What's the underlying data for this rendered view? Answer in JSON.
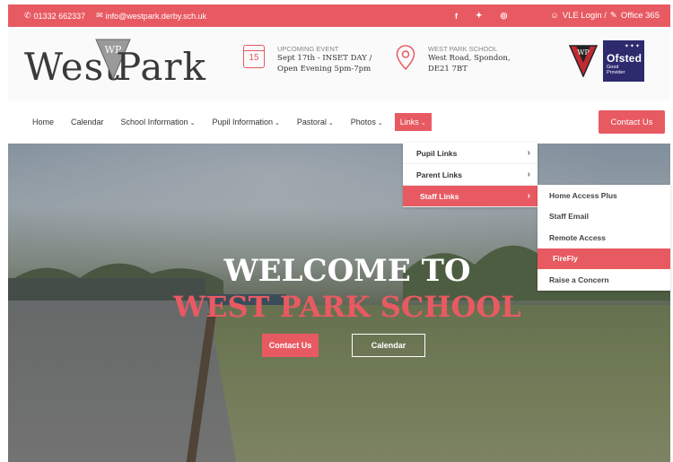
{
  "topbar": {
    "phone": "01332 662337",
    "email": "info@westpark.derby.sch.uk",
    "social_icons": [
      "facebook-icon",
      "twitter-icon",
      "instagram-icon"
    ],
    "vle_login": "VLE Login /",
    "office365": "Office 365"
  },
  "header": {
    "logo_left": "West",
    "logo_right": "Park",
    "logo_mark": "WP",
    "event": {
      "label": "UPCOMING EVENT",
      "day": "15",
      "line1": "Sept 17th - INSET DAY /",
      "line2": "Open Evening 5pm-7pm"
    },
    "school": {
      "label": "WEST PARK SCHOOL",
      "line1": "West Road, Spondon,",
      "line2": "DE21 7BT"
    },
    "ofsted": {
      "name": "Ofsted",
      "grade1": "Good",
      "grade2": "Provider"
    }
  },
  "nav": {
    "items": [
      {
        "label": "Home",
        "caret": ""
      },
      {
        "label": "Calendar",
        "caret": ""
      },
      {
        "label": "School Information",
        "caret": "⌄"
      },
      {
        "label": "Pupil Information",
        "caret": "⌄"
      },
      {
        "label": "Pastoral",
        "caret": "⌄"
      },
      {
        "label": "Photos",
        "caret": "⌄"
      },
      {
        "label": "Links",
        "caret": "⌄"
      }
    ],
    "contact": "Contact Us"
  },
  "links_menu": {
    "items": [
      "Pupil Links",
      "Parent Links",
      "Staff Links"
    ],
    "selected": "Staff Links"
  },
  "staff_menu": {
    "items": [
      "Home Access Plus",
      "Staff Email",
      "Remote Access",
      "FireFly",
      "Raise a Concern"
    ],
    "selected": "FireFly"
  },
  "hero": {
    "title1": "WELCOME TO",
    "title2": "WEST PARK SCHOOL",
    "btn_contact": "Contact Us",
    "btn_calendar": "Calendar"
  },
  "colors": {
    "accent": "#e85a62",
    "ofsted_navy": "#2d2a6e"
  }
}
